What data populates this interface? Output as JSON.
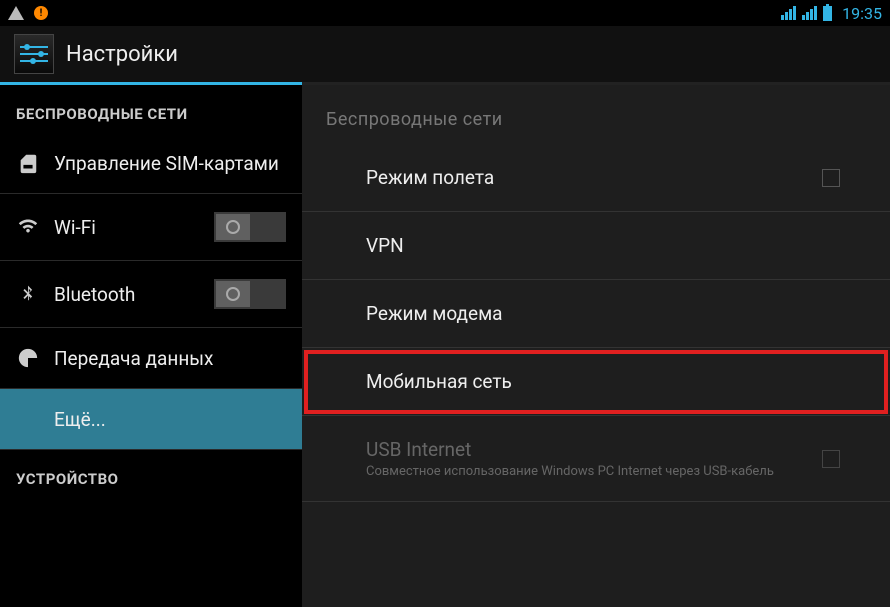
{
  "status": {
    "time": "19:35"
  },
  "header": {
    "title": "Настройки"
  },
  "sidebar": {
    "section_wireless": "БЕСПРОВОДНЫЕ СЕТИ",
    "section_device": "УСТРОЙСТВО",
    "items": {
      "sim": "Управление SIM-картами",
      "wifi": "Wi-Fi",
      "bluetooth": "Bluetooth",
      "data": "Передача данных",
      "more": "Ещё..."
    }
  },
  "content": {
    "section_wireless": "Беспроводные сети",
    "items": {
      "airplane": "Режим полета",
      "vpn": "VPN",
      "tether": "Режим модема",
      "mobile": "Мобильная сеть",
      "usb_title": "USB Internet",
      "usb_sub": "Совместное использование Windows PC Internet через USB-кабель"
    }
  }
}
